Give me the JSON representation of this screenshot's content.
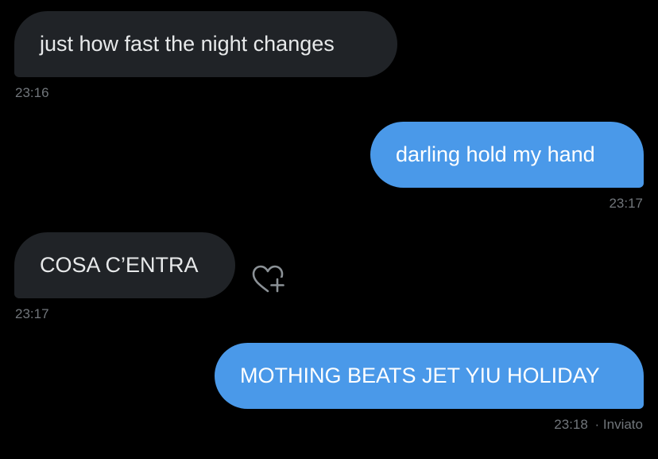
{
  "messages": [
    {
      "text": "just how fast the night changes",
      "time": "23:16",
      "direction": "incoming"
    },
    {
      "text": "darling hold my hand",
      "time": "23:17",
      "direction": "outgoing"
    },
    {
      "text": "COSA C’ENTRA",
      "time": "23:17",
      "direction": "incoming"
    },
    {
      "text": "MOTHING BEATS JET YIU HOLIDAY",
      "time": "23:18",
      "direction": "outgoing",
      "status": "· Inviato"
    }
  ],
  "icons": {
    "reaction": "heart-plus-icon"
  },
  "colors": {
    "background": "#000000",
    "incoming_bubble": "#202327",
    "outgoing_bubble": "#4a99e9",
    "timestamp": "#71767b"
  }
}
